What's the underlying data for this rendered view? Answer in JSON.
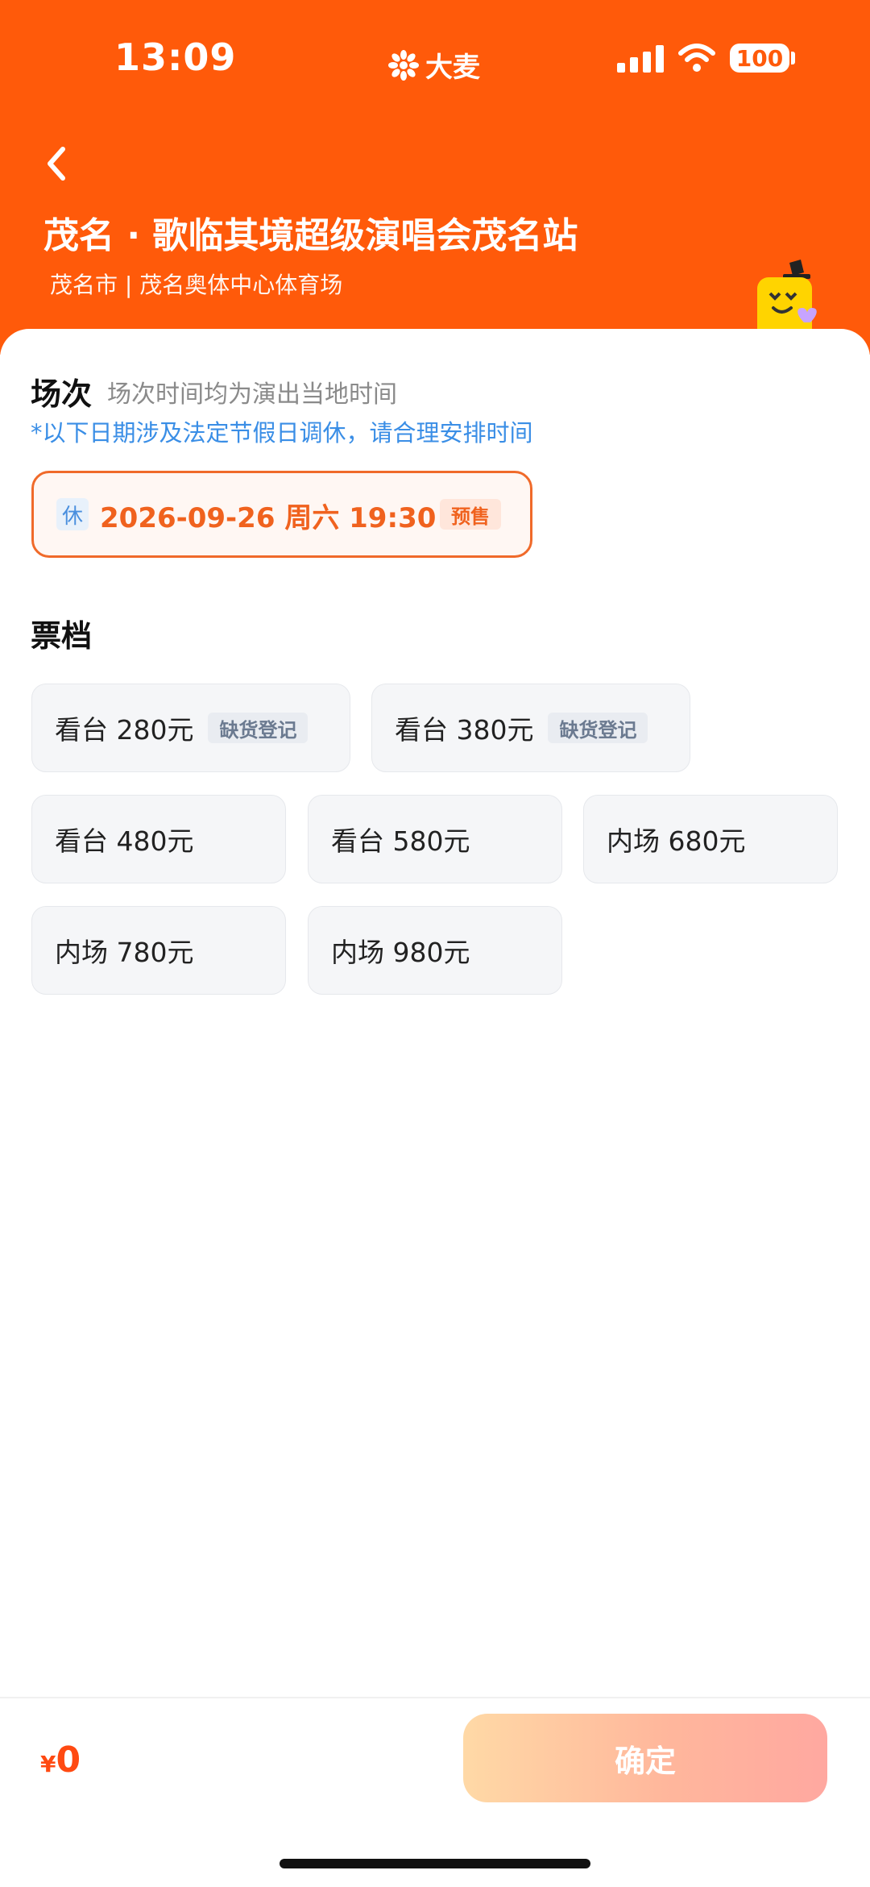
{
  "status_bar": {
    "time": "13:09",
    "brand": "大麦",
    "battery": "100"
  },
  "header": {
    "title": "茂名 · 歌临其境超级演唱会茂名站",
    "venue": "茂名市 | 茂名奥体中心体育场"
  },
  "session": {
    "title": "场次",
    "subtitle": "场次时间均为演出当地时间",
    "notice": "*以下日期涉及法定节假日调休，请合理安排时间",
    "rest_tag": "休",
    "datetime": "2026-09-26  周六 19:30",
    "status_tag": "预售"
  },
  "tiers": {
    "title": "票档",
    "items": [
      {
        "label": "看台 280元",
        "tag": "缺货登记"
      },
      {
        "label": "看台 380元",
        "tag": "缺货登记"
      },
      {
        "label": "看台 480元"
      },
      {
        "label": "看台 580元"
      },
      {
        "label": "内场 680元"
      },
      {
        "label": "内场 780元"
      },
      {
        "label": "内场 980元"
      }
    ]
  },
  "footer": {
    "currency": "¥",
    "total": "0",
    "confirm_label": "确定"
  },
  "colors": {
    "brand_orange": "#ff5a0a",
    "accent": "#f0621e",
    "notice_blue": "#3a8ee6"
  }
}
